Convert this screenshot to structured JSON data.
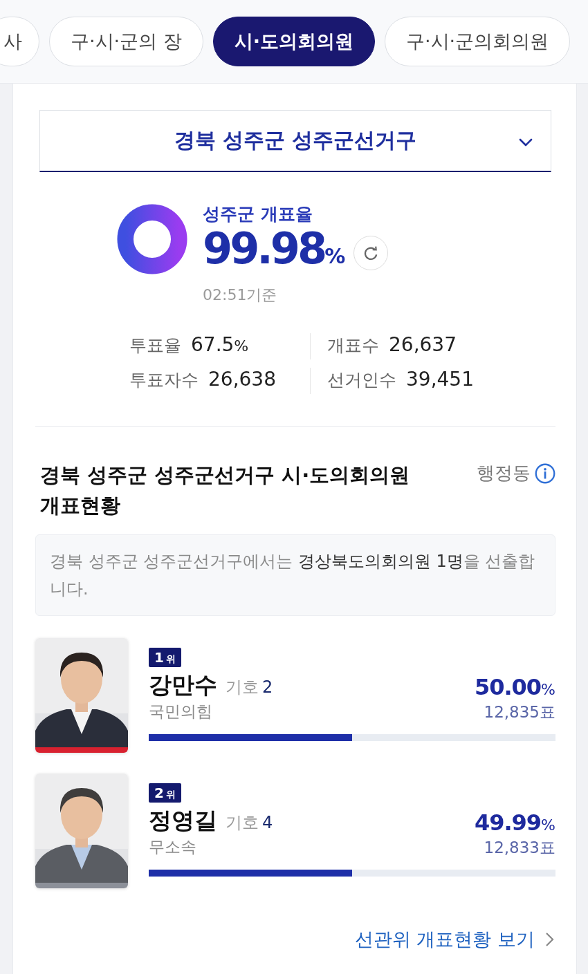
{
  "tabs": [
    {
      "label": "사",
      "selected": false
    },
    {
      "label": "구·시·군의 장",
      "selected": false
    },
    {
      "label": "시·도의회의원",
      "selected": true
    },
    {
      "label": "구·시·군의회의원",
      "selected": false
    }
  ],
  "district_select": {
    "value": "경북 성주군 성주군선거구"
  },
  "count_progress": {
    "label": "성주군 개표율",
    "value": "99.98",
    "unit": "%",
    "level": 0.9998,
    "time": "02:51기준"
  },
  "stats": [
    {
      "label": "투표율",
      "value": "67.5",
      "unit": "%"
    },
    {
      "label": "개표수",
      "value": "26,637"
    },
    {
      "label": "투표자수",
      "value": "26,638"
    },
    {
      "label": "선거인수",
      "value": "39,451"
    }
  ],
  "results": {
    "title": "경북 성주군 성주군선거구 시·도의회의원 개표현황",
    "filter_label": "행정동",
    "notice": "경북 성주군 성주군선거구에서는 **경상북도의회의원 1명**을 선출합니다.",
    "candidates": [
      {
        "rank": "1",
        "rank_unit": "위",
        "name": "강만수",
        "symbol_label": "기호",
        "symbol": "2",
        "party": "국민의힘",
        "color": "#d8212f",
        "percent": "50.00",
        "percent_unit": "%",
        "votes": "12,835표",
        "level": 0.5
      },
      {
        "rank": "2",
        "rank_unit": "위",
        "name": "정영길",
        "symbol_label": "기호",
        "symbol": "4",
        "party": "무소속",
        "color": "#8c9099",
        "percent": "49.99",
        "percent_unit": "%",
        "votes": "12,833표",
        "level": 0.4999
      }
    ],
    "link": "선관위 개표현황 보기"
  }
}
